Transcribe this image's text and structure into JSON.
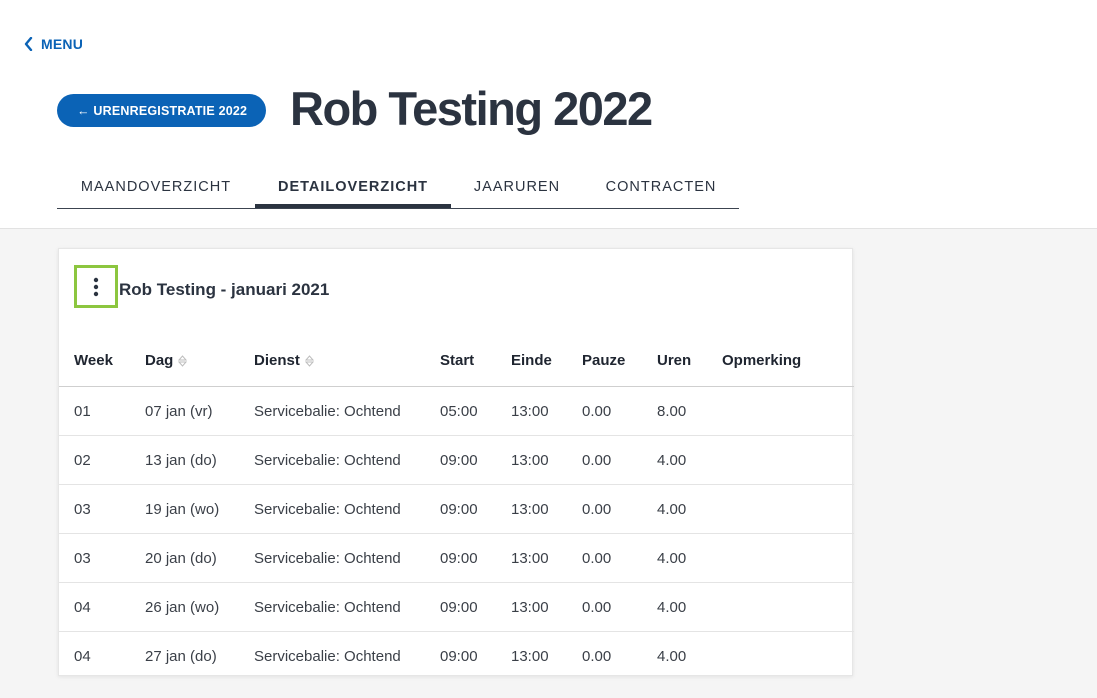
{
  "nav": {
    "menu_label": "MENU"
  },
  "header": {
    "back_label": "← URENREGISTRATIE 2022",
    "title": "Rob Testing 2022"
  },
  "tabs": [
    {
      "label": "MAANDOVERZICHT",
      "active": false
    },
    {
      "label": "DETAILOVERZICHT",
      "active": true
    },
    {
      "label": "JAARUREN",
      "active": false
    },
    {
      "label": "CONTRACTEN",
      "active": false
    }
  ],
  "card": {
    "title": "Rob Testing - januari 2021",
    "columns": [
      "Week",
      "Dag",
      "Dienst",
      "Start",
      "Einde",
      "Pauze",
      "Uren",
      "Opmerking"
    ],
    "rows": [
      {
        "week": "01",
        "dag": "07 jan (vr)",
        "dienst": "Servicebalie: Ochtend",
        "start": "05:00",
        "einde": "13:00",
        "pauze": "0.00",
        "uren": "8.00",
        "opmerking": ""
      },
      {
        "week": "02",
        "dag": "13 jan (do)",
        "dienst": "Servicebalie: Ochtend",
        "start": "09:00",
        "einde": "13:00",
        "pauze": "0.00",
        "uren": "4.00",
        "opmerking": ""
      },
      {
        "week": "03",
        "dag": "19 jan (wo)",
        "dienst": "Servicebalie: Ochtend",
        "start": "09:00",
        "einde": "13:00",
        "pauze": "0.00",
        "uren": "4.00",
        "opmerking": ""
      },
      {
        "week": "03",
        "dag": "20 jan (do)",
        "dienst": "Servicebalie: Ochtend",
        "start": "09:00",
        "einde": "13:00",
        "pauze": "0.00",
        "uren": "4.00",
        "opmerking": ""
      },
      {
        "week": "04",
        "dag": "26 jan (wo)",
        "dienst": "Servicebalie: Ochtend",
        "start": "09:00",
        "einde": "13:00",
        "pauze": "0.00",
        "uren": "4.00",
        "opmerking": ""
      },
      {
        "week": "04",
        "dag": "27 jan (do)",
        "dienst": "Servicebalie: Ochtend",
        "start": "09:00",
        "einde": "13:00",
        "pauze": "0.00",
        "uren": "4.00",
        "opmerking": ""
      }
    ]
  },
  "colors": {
    "primary": "#0b63b6",
    "text": "#2b3340",
    "highlight": "#8cc63f",
    "background": "#f5f5f5"
  }
}
